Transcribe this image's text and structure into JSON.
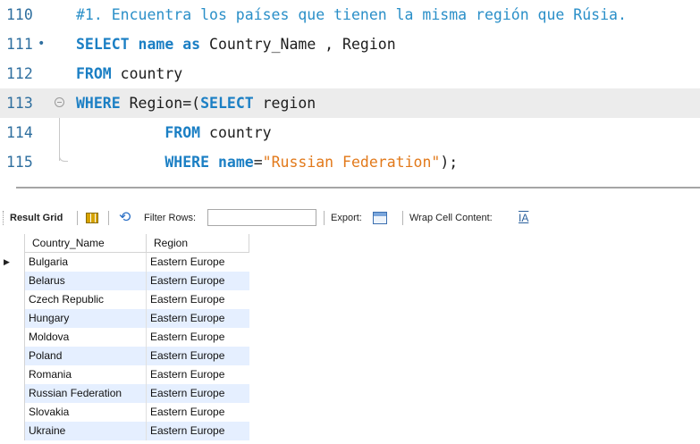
{
  "editor": {
    "lines": [
      {
        "number": "110",
        "comment": "#1. Encuentra los países que tienen la misma región que Rúsia."
      },
      {
        "number": "111",
        "marker": "•",
        "kw1": "SELECT",
        "kw2": "name",
        "kw3": "as",
        "rest": " Country_Name , Region"
      },
      {
        "number": "112",
        "kw1": "FROM",
        "rest": " country"
      },
      {
        "number": "113",
        "kw1": "WHERE",
        "rest": " Region=(",
        "kw2": "SELECT",
        "rest2": " region"
      },
      {
        "number": "114",
        "indent": "          ",
        "kw1": "FROM",
        "rest": " country"
      },
      {
        "number": "115",
        "indent": "          ",
        "kw1": "WHERE",
        "kw2": "name",
        "rest": "=",
        "str": "\"Russian Federation\"",
        "rest2": ");"
      }
    ],
    "current_line": "113"
  },
  "toolbar": {
    "result_grid_label": "Result Grid",
    "filter_rows_label": "Filter Rows:",
    "filter_value": "",
    "export_label": "Export:",
    "wrap_label": "Wrap Cell Content:",
    "wrap_icon_text": "IA"
  },
  "grid": {
    "columns": [
      "Country_Name",
      "Region"
    ],
    "rows": [
      [
        "Bulgaria",
        "Eastern Europe"
      ],
      [
        "Belarus",
        "Eastern Europe"
      ],
      [
        "Czech Republic",
        "Eastern Europe"
      ],
      [
        "Hungary",
        "Eastern Europe"
      ],
      [
        "Moldova",
        "Eastern Europe"
      ],
      [
        "Poland",
        "Eastern Europe"
      ],
      [
        "Romania",
        "Eastern Europe"
      ],
      [
        "Russian Federation",
        "Eastern Europe"
      ],
      [
        "Slovakia",
        "Eastern Europe"
      ],
      [
        "Ukraine",
        "Eastern Europe"
      ]
    ]
  }
}
